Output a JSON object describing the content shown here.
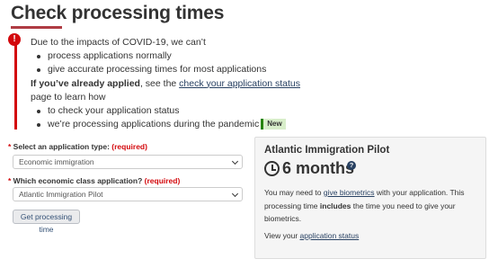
{
  "page": {
    "title": "Check processing times"
  },
  "alert": {
    "intro": "Due to the impacts of COVID-19, we can’t",
    "bullets": [
      "process applications normally",
      "give accurate processing times for most applications"
    ],
    "applied_strong": "If you’ve already applied",
    "applied_mid": ", see the ",
    "applied_link": "check your application status",
    "applied_end": " page to learn how",
    "bullets2": [
      "to check your application status",
      "we’re processing applications during the pandemic"
    ],
    "badge": "New"
  },
  "form": {
    "type_label": "Select an application type:",
    "type_required": "(required)",
    "type_value": "Economic immigration",
    "class_label": "Which economic class application?",
    "class_required": "(required)",
    "class_value": "Atlantic Immigration Pilot",
    "submit_label": "Get processing time"
  },
  "result": {
    "program": "Atlantic Immigration Pilot",
    "duration": "6 months",
    "note_a": "You may need to ",
    "note_link": "give biometrics",
    "note_b": " with your application. This processing time ",
    "note_strong": "includes",
    "note_c": " the time you need to give your biometrics.",
    "status_prefix": "View your ",
    "status_link": "application status"
  },
  "colors": {
    "accent": "#af3c43",
    "danger": "#d3080c",
    "link": "#284162",
    "badge_bg": "#d8eeca",
    "badge_border": "#278400"
  },
  "icons": {
    "alert": "exclamation-circle-icon",
    "clock": "clock-icon",
    "help": "question-circle-icon",
    "select": "chevron-down-icon"
  }
}
